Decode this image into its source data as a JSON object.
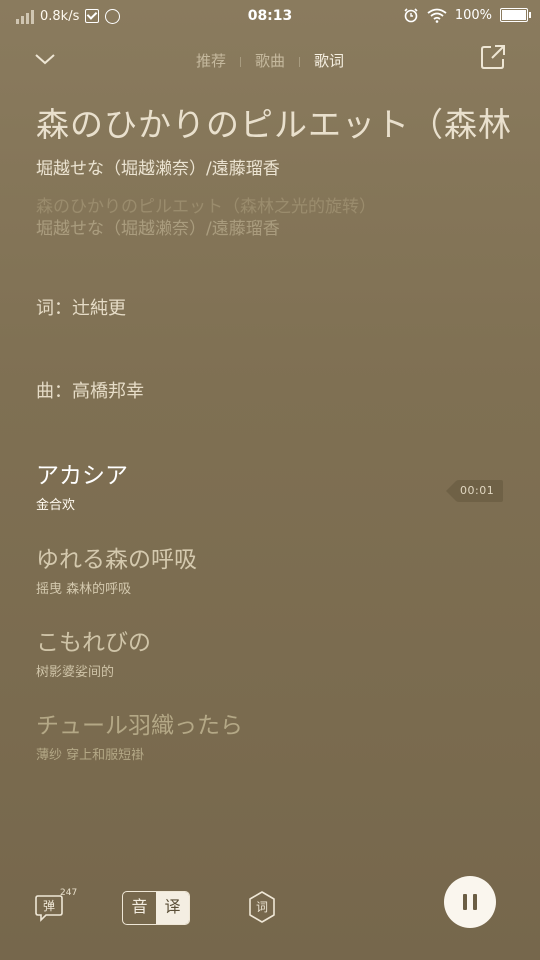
{
  "status_bar": {
    "speed": "0.8k/s",
    "time": "08:13",
    "battery": "100%"
  },
  "tabs": [
    {
      "label": "推荐",
      "active": false
    },
    {
      "label": "歌曲",
      "active": false
    },
    {
      "label": "歌词",
      "active": true
    }
  ],
  "song": {
    "title": "森のひかりのピルエット（森林",
    "artist": "堀越せな（堀越濑奈）/遠藤瑠香",
    "ghost_title": "森のひかりのピルエット（森林之光的旋转）",
    "ghost_artist": "堀越せな（堀越濑奈）/遠藤瑠香"
  },
  "credits": {
    "lyricist": "词：辻純更",
    "composer": "曲：高橋邦幸"
  },
  "lyrics": [
    {
      "jp": "アカシア",
      "cn": "金合欢"
    },
    {
      "jp": "ゆれる森の呼吸",
      "cn": "摇曳 森林的呼吸"
    },
    {
      "jp": "こもれびの",
      "cn": "树影婆娑间的"
    },
    {
      "jp": "チュール羽織ったら",
      "cn": "薄纱 穿上和服短褂"
    }
  ],
  "timestamp": "00:01",
  "controls": {
    "danmu_label": "弹",
    "danmu_count": "247",
    "yin_label": "音",
    "yi_label": "译",
    "ci_label": "词"
  },
  "colors": {
    "background": "#7f7053",
    "active_lyric": "#ffffff",
    "play_button": "#faf6ee"
  }
}
